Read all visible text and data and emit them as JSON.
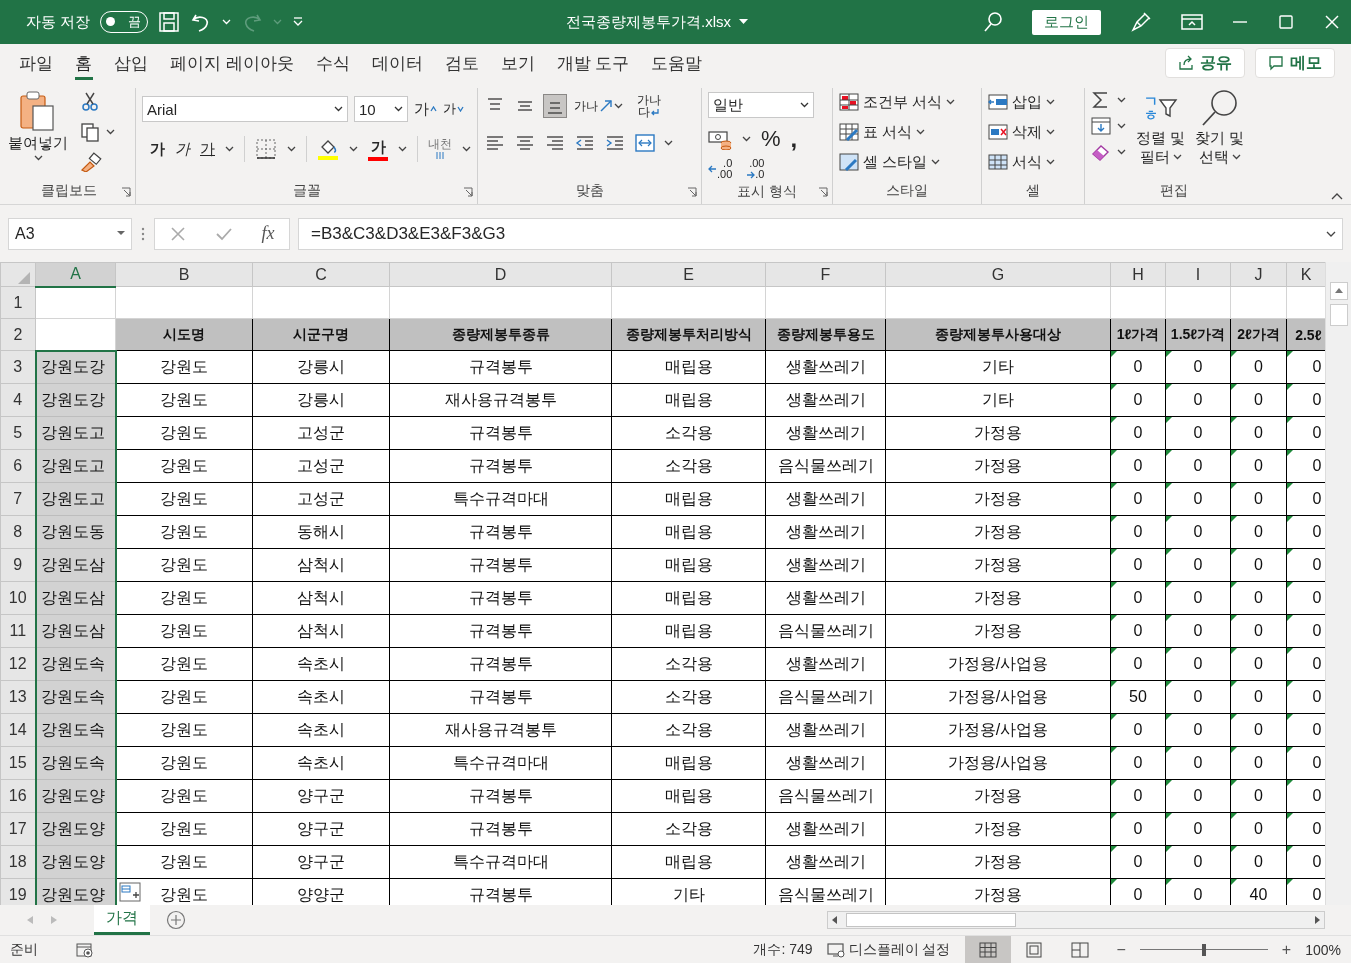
{
  "title_bar": {
    "autosave_label": "자동 저장",
    "autosave": {
      "on": false,
      "label": "끔"
    },
    "filename": "전국종량제봉투가격.xlsx",
    "login": "로그인"
  },
  "menu_tabs": [
    {
      "label": "파일",
      "selected": false
    },
    {
      "label": "홈",
      "selected": true
    },
    {
      "label": "삽입",
      "selected": false
    },
    {
      "label": "페이지 레이아웃",
      "selected": false
    },
    {
      "label": "수식",
      "selected": false
    },
    {
      "label": "데이터",
      "selected": false
    },
    {
      "label": "검토",
      "selected": false
    },
    {
      "label": "보기",
      "selected": false
    },
    {
      "label": "개발 도구",
      "selected": false
    },
    {
      "label": "도움말",
      "selected": false
    }
  ],
  "share_button": "공유",
  "memo_button": "메모",
  "ribbon": {
    "clipboard": {
      "paste": "붙여넣기",
      "group_label": "클립보드"
    },
    "font": {
      "font_name": "Arial",
      "font_size": "10",
      "grow": "가",
      "shrink": "가",
      "bold": "가",
      "italic": "가",
      "underline": "가",
      "font_color": "가",
      "phonetic": "내천",
      "group_label": "글꼴"
    },
    "alignment": {
      "vertical": [
        {
          "kind": "top",
          "selected": false
        },
        {
          "kind": "middle",
          "selected": false
        },
        {
          "kind": "bottom",
          "selected": true
        }
      ],
      "orientation": "가나",
      "wrap": [
        "가나",
        "다"
      ],
      "group_label": "맞춤"
    },
    "number": {
      "format": "일반",
      "percent": "%",
      "comma": ",",
      "increase_decimal": [
        ".0",
        ".00"
      ],
      "decrease_decimal": [
        ".00",
        ".0"
      ],
      "group_label": "표시 형식"
    },
    "styles": {
      "items": [
        "조건부 서식",
        "표 서식",
        "셀 스타일"
      ],
      "group_label": "스타일"
    },
    "cells": {
      "items": [
        "삽입",
        "삭제",
        "서식"
      ],
      "group_label": "셀"
    },
    "editing": {
      "sort_icon": [
        "ㄱ",
        "ㅎ"
      ],
      "sort_filter": [
        "정렬 및",
        "필터"
      ],
      "find_select": [
        "찾기 및",
        "선택"
      ],
      "group_label": "편집"
    }
  },
  "formula_bar": {
    "name_box": "A3",
    "fx": "fx",
    "formula": "=B3&C3&D3&E3&F3&G3"
  },
  "sheet": {
    "columns": [
      {
        "letter": "A",
        "selected": true,
        "kind": "text"
      },
      {
        "letter": "B",
        "selected": false,
        "kind": "text"
      },
      {
        "letter": "C",
        "selected": false,
        "kind": "text"
      },
      {
        "letter": "D",
        "selected": false,
        "kind": "text"
      },
      {
        "letter": "E",
        "selected": false,
        "kind": "text"
      },
      {
        "letter": "F",
        "selected": false,
        "kind": "text"
      },
      {
        "letter": "G",
        "selected": false,
        "kind": "text"
      },
      {
        "letter": "H",
        "selected": false,
        "kind": "number"
      },
      {
        "letter": "I",
        "selected": false,
        "kind": "number"
      },
      {
        "letter": "J",
        "selected": false,
        "kind": "number"
      },
      {
        "letter": "K",
        "selected": false,
        "kind": "number"
      }
    ],
    "error_indicators": true,
    "blank_row_number": "1",
    "header_row": {
      "number": "2",
      "titles": [
        "시도명",
        "시군구명",
        "종량제봉투종류",
        "종량제봉투처리방식",
        "종량제봉투용도",
        "종량제봉투사용대상",
        "1ℓ가격",
        "1.5ℓ가격",
        "2ℓ가격",
        "2.5ℓ"
      ]
    },
    "rows": [
      {
        "number": "3",
        "cells": [
          "강원도강",
          "강원도",
          "강릉시",
          "규격봉투",
          "매립용",
          "생활쓰레기",
          "기타",
          "0",
          "0",
          "0",
          "0"
        ]
      },
      {
        "number": "4",
        "cells": [
          "강원도강",
          "강원도",
          "강릉시",
          "재사용규격봉투",
          "매립용",
          "생활쓰레기",
          "기타",
          "0",
          "0",
          "0",
          "0"
        ]
      },
      {
        "number": "5",
        "cells": [
          "강원도고",
          "강원도",
          "고성군",
          "규격봉투",
          "소각용",
          "생활쓰레기",
          "가정용",
          "0",
          "0",
          "0",
          "0"
        ]
      },
      {
        "number": "6",
        "cells": [
          "강원도고",
          "강원도",
          "고성군",
          "규격봉투",
          "소각용",
          "음식물쓰레기",
          "가정용",
          "0",
          "0",
          "0",
          "0"
        ]
      },
      {
        "number": "7",
        "cells": [
          "강원도고",
          "강원도",
          "고성군",
          "특수규격마대",
          "매립용",
          "생활쓰레기",
          "가정용",
          "0",
          "0",
          "0",
          "0"
        ]
      },
      {
        "number": "8",
        "cells": [
          "강원도동",
          "강원도",
          "동해시",
          "규격봉투",
          "매립용",
          "생활쓰레기",
          "가정용",
          "0",
          "0",
          "0",
          "0"
        ]
      },
      {
        "number": "9",
        "cells": [
          "강원도삼",
          "강원도",
          "삼척시",
          "규격봉투",
          "매립용",
          "생활쓰레기",
          "가정용",
          "0",
          "0",
          "0",
          "0"
        ]
      },
      {
        "number": "10",
        "cells": [
          "강원도삼",
          "강원도",
          "삼척시",
          "규격봉투",
          "매립용",
          "생활쓰레기",
          "가정용",
          "0",
          "0",
          "0",
          "0"
        ]
      },
      {
        "number": "11",
        "cells": [
          "강원도삼",
          "강원도",
          "삼척시",
          "규격봉투",
          "매립용",
          "음식물쓰레기",
          "가정용",
          "0",
          "0",
          "0",
          "0"
        ]
      },
      {
        "number": "12",
        "cells": [
          "강원도속",
          "강원도",
          "속초시",
          "규격봉투",
          "소각용",
          "생활쓰레기",
          "가정용/사업용",
          "0",
          "0",
          "0",
          "0"
        ]
      },
      {
        "number": "13",
        "cells": [
          "강원도속",
          "강원도",
          "속초시",
          "규격봉투",
          "소각용",
          "음식물쓰레기",
          "가정용/사업용",
          "50",
          "0",
          "0",
          "0"
        ]
      },
      {
        "number": "14",
        "cells": [
          "강원도속",
          "강원도",
          "속초시",
          "재사용규격봉투",
          "소각용",
          "생활쓰레기",
          "가정용/사업용",
          "0",
          "0",
          "0",
          "0"
        ]
      },
      {
        "number": "15",
        "cells": [
          "강원도속",
          "강원도",
          "속초시",
          "특수규격마대",
          "매립용",
          "생활쓰레기",
          "가정용/사업용",
          "0",
          "0",
          "0",
          "0"
        ]
      },
      {
        "number": "16",
        "cells": [
          "강원도양",
          "강원도",
          "양구군",
          "규격봉투",
          "매립용",
          "음식물쓰레기",
          "가정용",
          "0",
          "0",
          "0",
          "0"
        ]
      },
      {
        "number": "17",
        "cells": [
          "강원도양",
          "강원도",
          "양구군",
          "규격봉투",
          "소각용",
          "생활쓰레기",
          "가정용",
          "0",
          "0",
          "0",
          "0"
        ]
      },
      {
        "number": "18",
        "cells": [
          "강원도양",
          "강원도",
          "양구군",
          "특수규격마대",
          "매립용",
          "생활쓰레기",
          "가정용",
          "0",
          "0",
          "0",
          "0"
        ]
      },
      {
        "number": "19",
        "cells": [
          "강원도양",
          "강원도",
          "양양군",
          "규격봉투",
          "기타",
          "음식물쓰레기",
          "가정용",
          "0",
          "0",
          "40",
          "0"
        ]
      }
    ]
  },
  "sheet_tabs": [
    {
      "label": "가격",
      "selected": true
    }
  ],
  "status_bar": {
    "ready": "준비",
    "count": "개수: 749",
    "display_settings": "디스플레이 설정",
    "views": [
      {
        "kind": "normal",
        "selected": true
      },
      {
        "kind": "page_layout",
        "selected": false
      },
      {
        "kind": "page_break",
        "selected": false
      }
    ],
    "zoom_out": "−",
    "zoom_in": "+",
    "zoom": {
      "level": 0.5,
      "reading": "100%"
    }
  }
}
